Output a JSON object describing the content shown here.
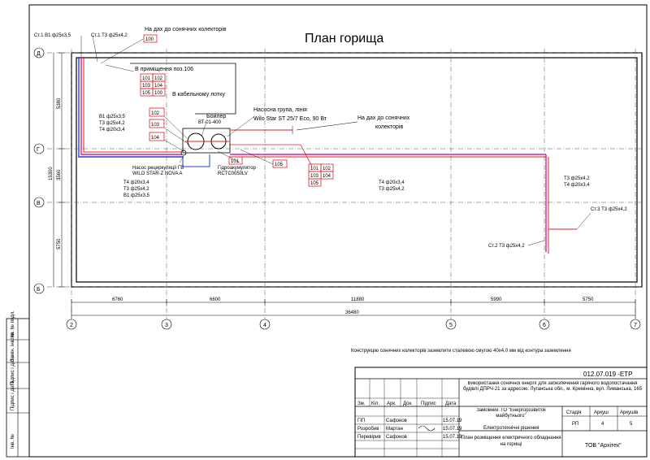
{
  "plan_title": "План горища",
  "axis_letters": [
    "Д",
    "Г",
    "В",
    "Б"
  ],
  "axis_numbers": [
    "2",
    "3",
    "4",
    "5",
    "6",
    "7"
  ],
  "left_dims": [
    "5380",
    "3560",
    "15300",
    "5750"
  ],
  "bottom_dims": [
    "6760",
    "6600",
    "11880",
    "5990",
    "5750",
    "36480"
  ],
  "labels": {
    "st1_v1": "Ст.1 В1 ф25х3,5",
    "st1_t3": "Ст.1 Т3 ф25х4,2",
    "roof_collectors_top": "На дах до сонячних колекторів",
    "box_100": "100",
    "in_room": "В приміщення поз.106",
    "in_cable_tray": "В кабельному лотку",
    "pipes_left_1": "В1 ф25х3,5",
    "pipes_left_2": "Т3 ф25х4,2",
    "pipes_left_3": "Т4 ф20х3,4",
    "boiler_title": "Бойлер",
    "boiler_model": "ВТ-01-400",
    "pump_group_1": "Насосна група, лінія",
    "pump_group_2": "Wilo Star ST 25/7 Eco, 90 Вт",
    "roof_collectors_right_1": "На дах до сонячних",
    "roof_collectors_right_2": "колекторів",
    "recirc_pump_1": "Насос рециркуляції ГВ",
    "recirc_pump_2": "WILO STAR-Z NOVA A",
    "accumulator_1": "Гідроакумулятор",
    "accumulator_2": "RCTC0050LV",
    "pipes_under_1": "Т4 ф20х3,4",
    "pipes_under_2": "Т3 ф25х4,2",
    "pipes_under_3": "В1 ф25х3,5",
    "pipes_mid_1": "Т4 ф20х3,4",
    "pipes_mid_2": "Т3 ф25х4,2",
    "pipes_right_1": "Т3 ф25х4,2",
    "pipes_right_2": "Т4 ф20х3,4",
    "st3_t3": "Ст.3 Т3 ф25х4,2",
    "st2_t3": "Ст.2 Т3 ф25х4,2",
    "grounding_note": "Конструкцію сонячних колекторів заземлити сталевою смугою 40х4,0 мм від контура заземлення"
  },
  "box_groups": {
    "g1": [
      "101",
      "102",
      "103",
      "104",
      "105",
      "100"
    ],
    "g2": [
      "102",
      "103",
      "104"
    ],
    "g3": [
      "101",
      "105"
    ],
    "g4": [
      "101",
      "102",
      "103",
      "104",
      "105"
    ]
  },
  "side_stamp": [
    "Інв. № подл.",
    "Підпис і дата",
    "Замін. інв. №",
    "Підпис і дата",
    "Інв. №"
  ],
  "stamp": {
    "code": "012.07.019 -ЕТР",
    "project_desc": "Використання сонячної енергії для забезпечення гарячого водопостачання будівлі ДПРЧ-21 за адресою: Луганська обл., м. Кремінна, вул. Лиманська, 165",
    "customer": "Замовник: ГО \"Енергорозвиток майбутнього\"",
    "section": "Електротехнічні рішення",
    "sheet_title": "План розміщення електричного обладнання на горищі",
    "org": "ТОВ \"Архітек\"",
    "col_headers": [
      "Зм.",
      "Кіл.",
      "Арк.",
      "Док.",
      "Підпис",
      "Дата"
    ],
    "stage_headers": [
      "Стадія",
      "Аркуш",
      "Аркушів"
    ],
    "stage_values": [
      "РП",
      "4",
      "5"
    ],
    "roles": [
      {
        "role": "ГІП",
        "name": "Сафонов",
        "date": "15.07.19"
      },
      {
        "role": "Розробив",
        "name": "Мартан",
        "date": "15.07.19"
      },
      {
        "role": "Перевірив",
        "name": "Сафонов",
        "date": "15.07.19"
      }
    ]
  }
}
